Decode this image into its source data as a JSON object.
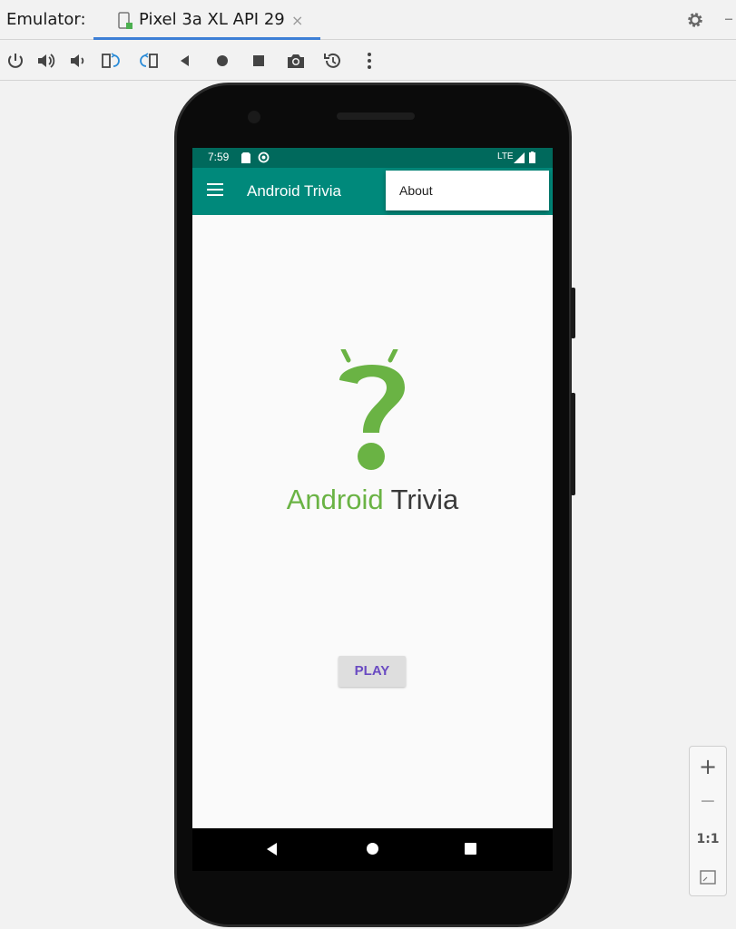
{
  "ide": {
    "label": "Emulator:",
    "tab_title": "Pixel 3a XL API 29",
    "tab_close": "×",
    "settings_icon": "gear-icon",
    "more_icon": "more-icon"
  },
  "toolbar": {
    "items": [
      "power-icon",
      "volume-up-icon",
      "volume-down-icon",
      "rotate-left-icon",
      "rotate-right-icon",
      "back-icon",
      "home-icon",
      "overview-icon",
      "screenshot-icon",
      "snapshot-icon",
      "more-vertical-icon"
    ]
  },
  "device": {
    "status_time": "7:59",
    "status_network": "LTE",
    "app_title": "Android Trivia",
    "menu_item": "About",
    "logo_word1": "Android",
    "logo_word2": "Trivia",
    "play_label": "PLAY"
  },
  "zoom": {
    "plus": "+",
    "minus": "−",
    "one_to_one": "1:1"
  },
  "colors": {
    "status_bar": "#00695c",
    "app_bar": "#00897b",
    "logo_green": "#6ab344",
    "play_text": "#6a4bc2",
    "tab_underline": "#3d7fd6"
  }
}
